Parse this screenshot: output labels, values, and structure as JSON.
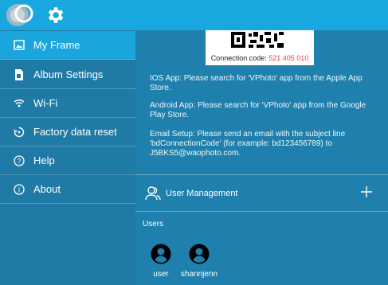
{
  "colors": {
    "topbar": "#18a7de",
    "sidebar": "#1f7aa6",
    "sidebar_active": "#1aa6dc",
    "main": "#1f80ad",
    "connection_code": "#e8463a"
  },
  "topbar": {
    "logo_icon": "app-logo-icon",
    "settings_icon": "gear-icon"
  },
  "sidebar": {
    "items": [
      {
        "label": "My Frame",
        "icon": "picture-icon",
        "active": true
      },
      {
        "label": "Album Settings",
        "icon": "album-icon",
        "active": false
      },
      {
        "label": "Wi-Fi",
        "icon": "wifi-icon",
        "active": false
      },
      {
        "label": "Factory data reset",
        "icon": "reset-icon",
        "active": false
      },
      {
        "label": "Help",
        "icon": "help-icon",
        "active": false
      },
      {
        "label": "About",
        "icon": "info-icon",
        "active": false
      }
    ]
  },
  "main": {
    "connection": {
      "label": "Connection code: ",
      "code": "521 405 010"
    },
    "ios_text": "IOS App: Please search for 'VPhoto' app from the Apple App Store.",
    "android_text": "Android App: Please search for 'VPhoto' app from the Google Play Store.",
    "email_text": "Email Setup: Please send an email with the subject line 'bdConnectionCode' (for example: bd123456789) to J5BKS5@waophoto.com.",
    "user_management": {
      "label": "User Management",
      "icon": "users-icon",
      "add_icon": "plus-icon"
    },
    "users_label": "Users",
    "users": [
      {
        "name": "user"
      },
      {
        "name": "shannjenn"
      }
    ]
  }
}
